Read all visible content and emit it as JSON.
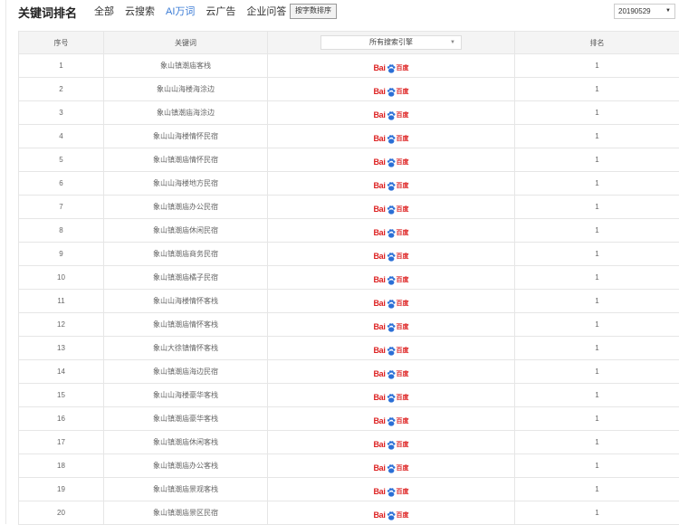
{
  "header": {
    "title": "关键词排名",
    "tabs": [
      {
        "label": "全部",
        "active": false
      },
      {
        "label": "云搜索",
        "active": false
      },
      {
        "label": "AI万词",
        "active": true
      },
      {
        "label": "云广告",
        "active": false
      },
      {
        "label": "企业问答",
        "active": false
      }
    ],
    "sort_button": "按字数排序",
    "date_value": "20190529"
  },
  "table": {
    "columns": [
      "序号",
      "关键词",
      "所有搜索引擎",
      "排名"
    ],
    "engine_icon": "baidu-logo-icon",
    "engine_text": "百度",
    "rows": [
      {
        "no": "1",
        "keyword": "象山镇潮庙客栈",
        "rank": "1"
      },
      {
        "no": "2",
        "keyword": "象山山海楼海涂边",
        "rank": "1"
      },
      {
        "no": "3",
        "keyword": "象山镇潮庙海涂边",
        "rank": "1"
      },
      {
        "no": "4",
        "keyword": "象山山海楼情怀民宿",
        "rank": "1"
      },
      {
        "no": "5",
        "keyword": "象山镇潮庙情怀民宿",
        "rank": "1"
      },
      {
        "no": "6",
        "keyword": "象山山海楼地方民宿",
        "rank": "1"
      },
      {
        "no": "7",
        "keyword": "象山镇潮庙办公民宿",
        "rank": "1"
      },
      {
        "no": "8",
        "keyword": "象山镇潮庙休闲民宿",
        "rank": "1"
      },
      {
        "no": "9",
        "keyword": "象山镇潮庙商务民宿",
        "rank": "1"
      },
      {
        "no": "10",
        "keyword": "象山镇潮庙橘子民宿",
        "rank": "1"
      },
      {
        "no": "11",
        "keyword": "象山山海楼情怀客栈",
        "rank": "1"
      },
      {
        "no": "12",
        "keyword": "象山镇潮庙情怀客栈",
        "rank": "1"
      },
      {
        "no": "13",
        "keyword": "象山大徐镇情怀客栈",
        "rank": "1"
      },
      {
        "no": "14",
        "keyword": "象山镇潮庙海边民宿",
        "rank": "1"
      },
      {
        "no": "15",
        "keyword": "象山山海楼豪华客栈",
        "rank": "1"
      },
      {
        "no": "16",
        "keyword": "象山镇潮庙豪华客栈",
        "rank": "1"
      },
      {
        "no": "17",
        "keyword": "象山镇潮庙休闲客栈",
        "rank": "1"
      },
      {
        "no": "18",
        "keyword": "象山镇潮庙办公客栈",
        "rank": "1"
      },
      {
        "no": "19",
        "keyword": "象山镇潮庙景观客栈",
        "rank": "1"
      },
      {
        "no": "20",
        "keyword": "象山镇潮庙景区民宿",
        "rank": "1"
      }
    ]
  }
}
